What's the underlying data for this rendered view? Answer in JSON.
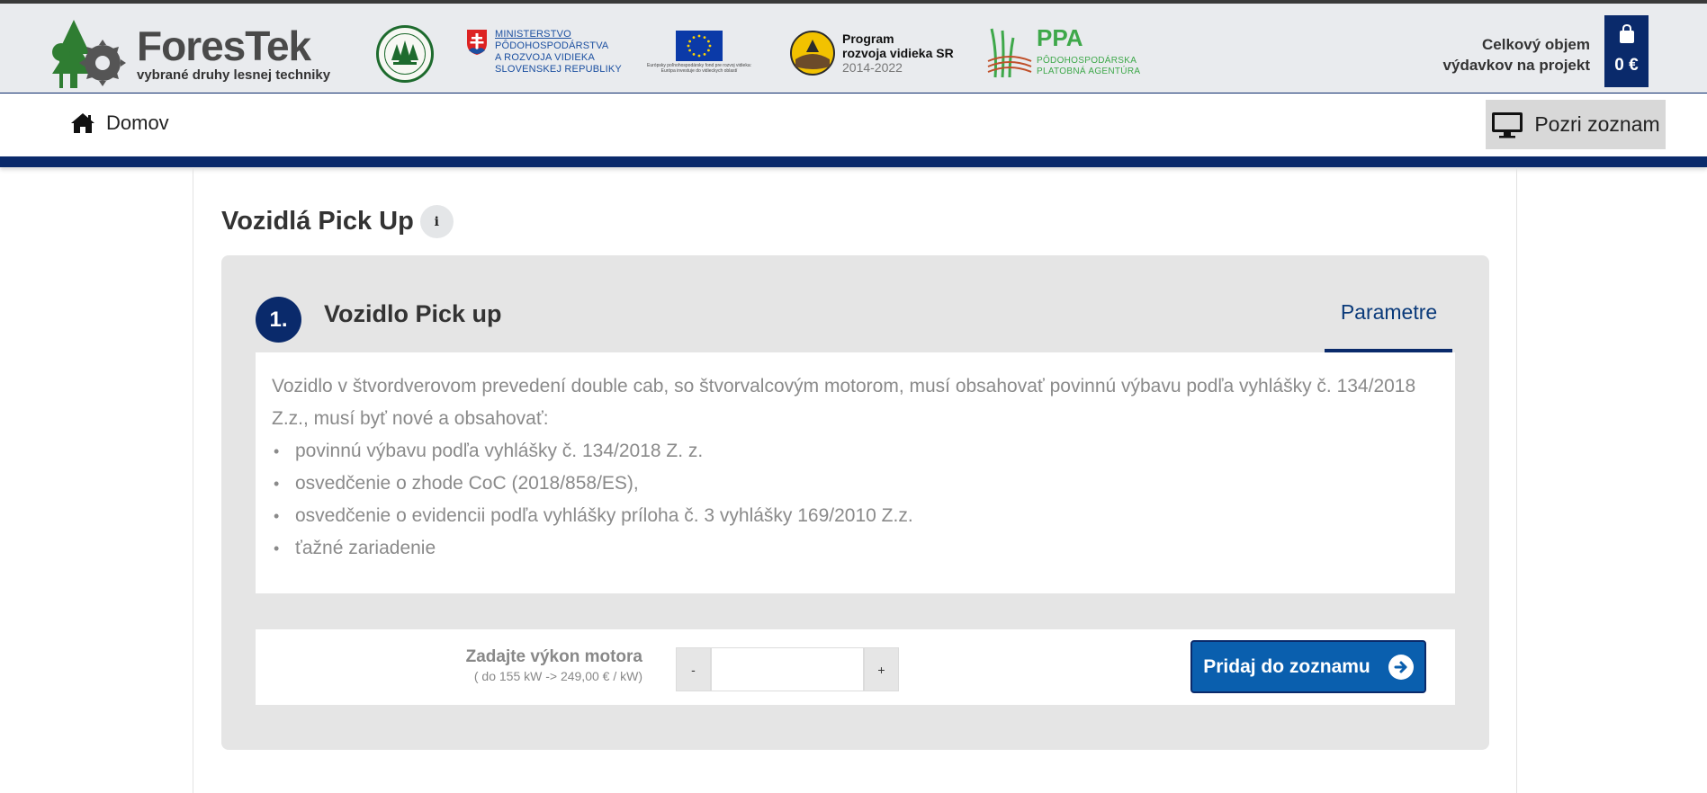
{
  "header": {
    "brand_name": "ForesTek",
    "brand_sub": "vybrané druhy lesnej techniky",
    "ministry_lines": [
      "MINISTERSTVO",
      "PÔDOHOSPODÁRSTVA",
      "A ROZVOJA VIDIEKA",
      "SLOVENSKEJ REPUBLIKY"
    ],
    "eu_caption": "Európsky poľnohospodársky fond pre rozvoj vidieka: Európa investuje do vidieckych oblastí",
    "program_lines": [
      "Program",
      "rozvoja vidieka SR",
      "2014-2022"
    ],
    "ppa_title": "PPA",
    "ppa_sub": [
      "PÔDOHOSPODÁRSKA",
      "PLATOBNÁ AGENTÚRA"
    ],
    "total_label_1": "Celkový objem",
    "total_label_2": "výdavkov na projekt",
    "cart_sum": "0 €"
  },
  "nav": {
    "home_label": "Domov",
    "view_list_label": "Pozri zoznam"
  },
  "page": {
    "title": "Vozidlá Pick Up",
    "info_icon": "i"
  },
  "item": {
    "number": "1.",
    "title": "Vozidlo Pick up",
    "tab_label": "Parametre",
    "description_1": "Vozidlo v štvordverovom prevedení double cab, so štvorvalcovým motorom, musí obsahovať povinnú výbavu podľa vyhlášky č. 134/2018",
    "description_2": "Z.z., musí byť nové a obsahovať:",
    "bullets": [
      "povinnú výbavu podľa vyhlášky č. 134/2018 Z. z.",
      "osvedčenie o zhode CoC (2018/858/ES),",
      "osvedčenie o evidencii podľa vyhlášky príloha č. 3 vyhlášky 169/2010 Z.z.",
      "ťažné zariadenie"
    ],
    "input_label": "Zadajte výkon motora",
    "input_hint": "( do 155 kW -> 249,00 € / kW)",
    "minus": "-",
    "plus": "+",
    "input_value": "",
    "add_label": "Pridaj do zoznamu"
  },
  "colors": {
    "navy": "#0a2a6b",
    "button_blue": "#0a5fae",
    "ppa_green": "#3ea84a"
  }
}
